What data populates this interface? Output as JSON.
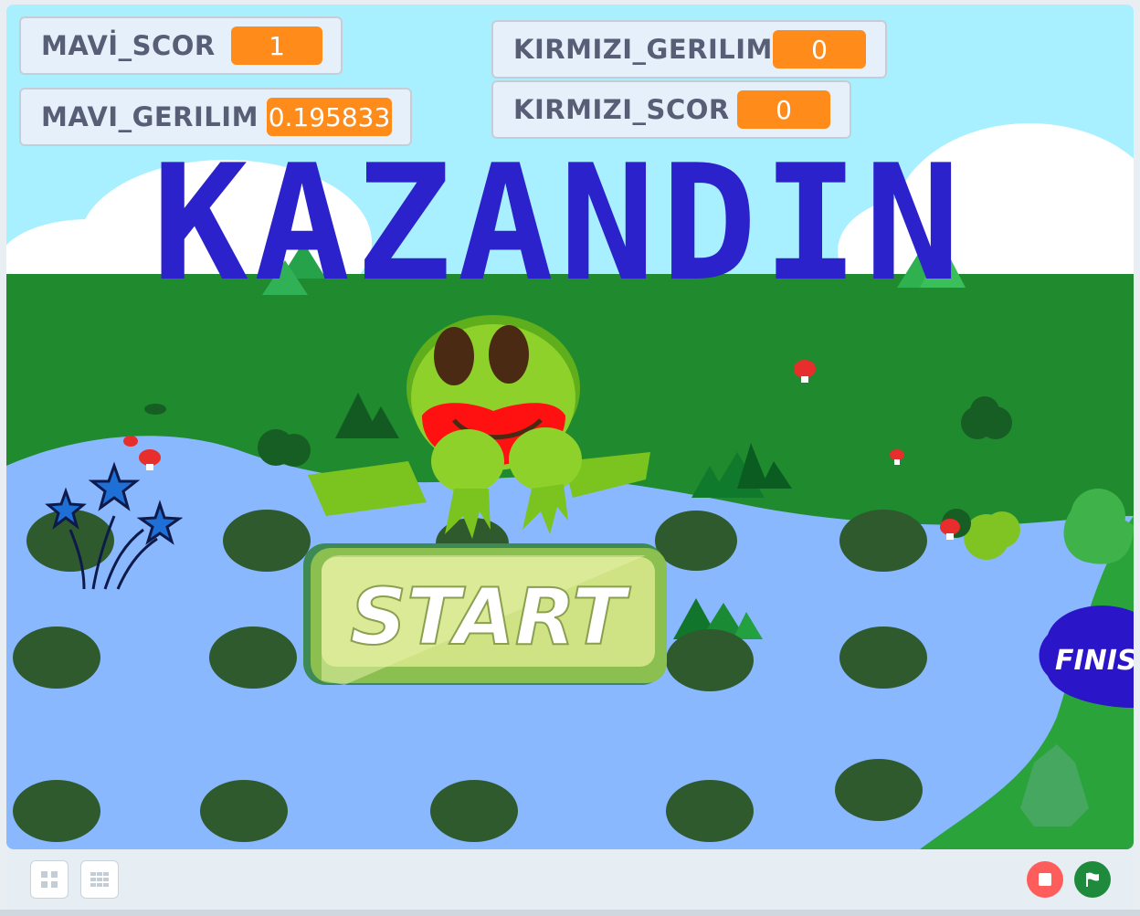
{
  "monitors": {
    "mavi_scor": {
      "label": "MAVİ_SCOR",
      "value": "1"
    },
    "mavi_gerilim": {
      "label": "MAVI_GERILIM",
      "value": "0.195833"
    },
    "kirmizi_gerilim": {
      "label": "KIRMIZI_GERILIM",
      "value": "0"
    },
    "kirmizi_scor": {
      "label": "KIRMIZI_SCOR",
      "value": "0"
    }
  },
  "stage": {
    "title": "KAZANDIN",
    "start_label": "START",
    "finish_label": "FINIS"
  },
  "icons": {
    "stop": "stop-icon",
    "green_flag": "green-flag-icon",
    "small_stage": "small-stage-icon",
    "normal_stage": "grid-icon"
  },
  "colors": {
    "sky": "#a8f0ff",
    "grass": "#1f8a2e",
    "water": "#8ab8ff",
    "title": "#2b22cc",
    "monitor_value": "#ff8c1a",
    "stop": "#ff5c5c",
    "flag": "#1e8a3c"
  }
}
